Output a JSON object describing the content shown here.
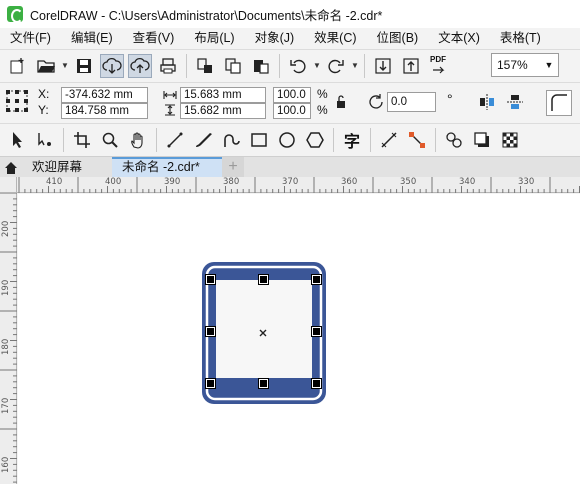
{
  "window": {
    "title": "CorelDRAW - C:\\Users\\Administrator\\Documents\\未命名 -2.cdr*"
  },
  "menu": [
    {
      "label": "文件(F)"
    },
    {
      "label": "编辑(E)"
    },
    {
      "label": "查看(V)"
    },
    {
      "label": "布局(L)"
    },
    {
      "label": "对象(J)"
    },
    {
      "label": "效果(C)"
    },
    {
      "label": "位图(B)"
    },
    {
      "label": "文本(X)"
    },
    {
      "label": "表格(T)"
    }
  ],
  "standard_toolbar": {
    "pdf_label": "PDF",
    "zoom_level": "157%"
  },
  "property_bar": {
    "x_label": "X:",
    "y_label": "Y:",
    "x_value": "-374.632 mm",
    "y_value": "184.758 mm",
    "width_value": "15.683 mm",
    "height_value": "15.682 mm",
    "scale_x": "100.0",
    "scale_y": "100.0",
    "percent": "%",
    "rotation": "0.0",
    "degree": "°"
  },
  "toolbox": {
    "text_tool_glyph": "字"
  },
  "tabs": {
    "welcome": "欢迎屏幕",
    "document": "未命名 -2.cdr*",
    "add": "+"
  },
  "ruler": {
    "h_labels": [
      "410",
      "400",
      "390",
      "380",
      "370",
      "360",
      "350",
      "340",
      "330"
    ],
    "v_labels": [
      "200",
      "190",
      "180",
      "170",
      "160"
    ]
  },
  "colors": {
    "frame_fill": "#3b5697",
    "accent": "#5a9bd8"
  }
}
